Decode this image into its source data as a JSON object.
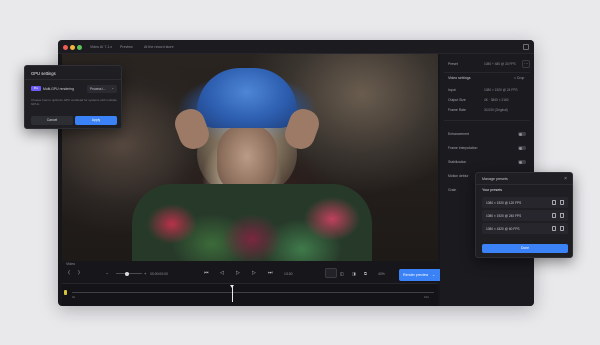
{
  "window": {
    "tabs": [
      "Video AI 7.1.x",
      "Preview",
      "At the record store"
    ]
  },
  "controls": {
    "section_label": "Video",
    "timecode": "00:00:00:00",
    "counter": "1/100",
    "zoom": "40%",
    "render_button": "Render preview"
  },
  "timeline": {
    "start": "0s",
    "end": "10s"
  },
  "sidebar": {
    "preset_label": "Preset",
    "preset_value": "1080 + 480 @ 30 FPS",
    "video_settings": "Video settings",
    "crop_label": "Crop",
    "rows": [
      {
        "label": "Input",
        "value": "1080 × 1920 @ 24 FPS"
      },
      {
        "label": "Output Size",
        "value": "4K · 3840 × 2160"
      },
      {
        "label": "Frame Rate",
        "value": "30,000 (Original)"
      }
    ],
    "toggles": [
      {
        "label": "Enhancement"
      },
      {
        "label": "Frame Interpolation"
      },
      {
        "label": "Stabilization"
      },
      {
        "label": "Motion deblur"
      },
      {
        "label": "Grain"
      }
    ]
  },
  "gpu_dialog": {
    "title": "GPU settings",
    "badge": "Pro",
    "option_label": "Multi-GPU rendering",
    "select_value": "Process i...",
    "description": "Choose how to optimize GPU workload for systems with multiple GPUs.",
    "cancel": "Cancel",
    "apply": "Apply"
  },
  "presets_dialog": {
    "title": "Manage presets",
    "close": "×",
    "subtitle": "Your presets",
    "items": [
      {
        "label": "1080 × 1920 @ 120 FPS"
      },
      {
        "label": "1080 × 1920 @ 240 FPS"
      },
      {
        "label": "1080 × 4320 @ 60 FPS"
      }
    ],
    "done": "Done"
  },
  "colors": {
    "accent": "#3b82f6",
    "pro_badge": "#6d5cf6",
    "app_bg": "#17171b"
  }
}
